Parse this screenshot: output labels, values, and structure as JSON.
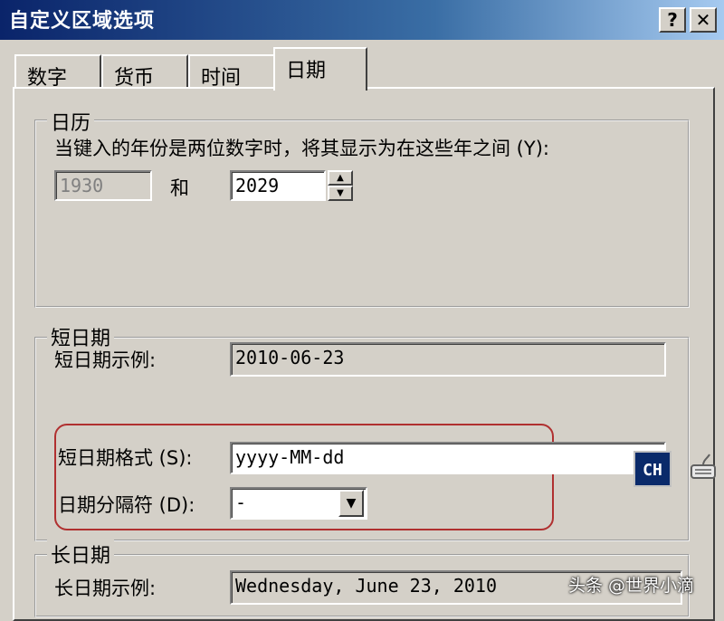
{
  "window": {
    "title": "自定义区域选项",
    "help_label": "?",
    "close_label": "✕"
  },
  "tabs": [
    {
      "label": "数字",
      "active": false
    },
    {
      "label": "货币",
      "active": false
    },
    {
      "label": "时间",
      "active": false
    },
    {
      "label": "日期",
      "active": true
    }
  ],
  "calendar": {
    "group_title": "日历",
    "description": "当键入的年份是两位数字时，将其显示为在这些年之间 (Y):",
    "year_from": "1930",
    "and_label": "和",
    "year_to": "2029"
  },
  "short_date": {
    "group_title": "短日期",
    "example_label": "短日期示例:",
    "example_value": "2010-06-23",
    "format_label": "短日期格式 (S):",
    "format_value": "yyyy-MM-dd",
    "separator_label": "日期分隔符 (D):",
    "separator_value": "-"
  },
  "long_date": {
    "group_title": "长日期",
    "example_label": "长日期示例:",
    "example_value": "Wednesday, June 23, 2010"
  },
  "ime_indicator": "CH",
  "watermark": "头条 @世界小滴",
  "icons": {
    "spin_up": "▲",
    "spin_down": "▼",
    "dropdown": "▼"
  }
}
